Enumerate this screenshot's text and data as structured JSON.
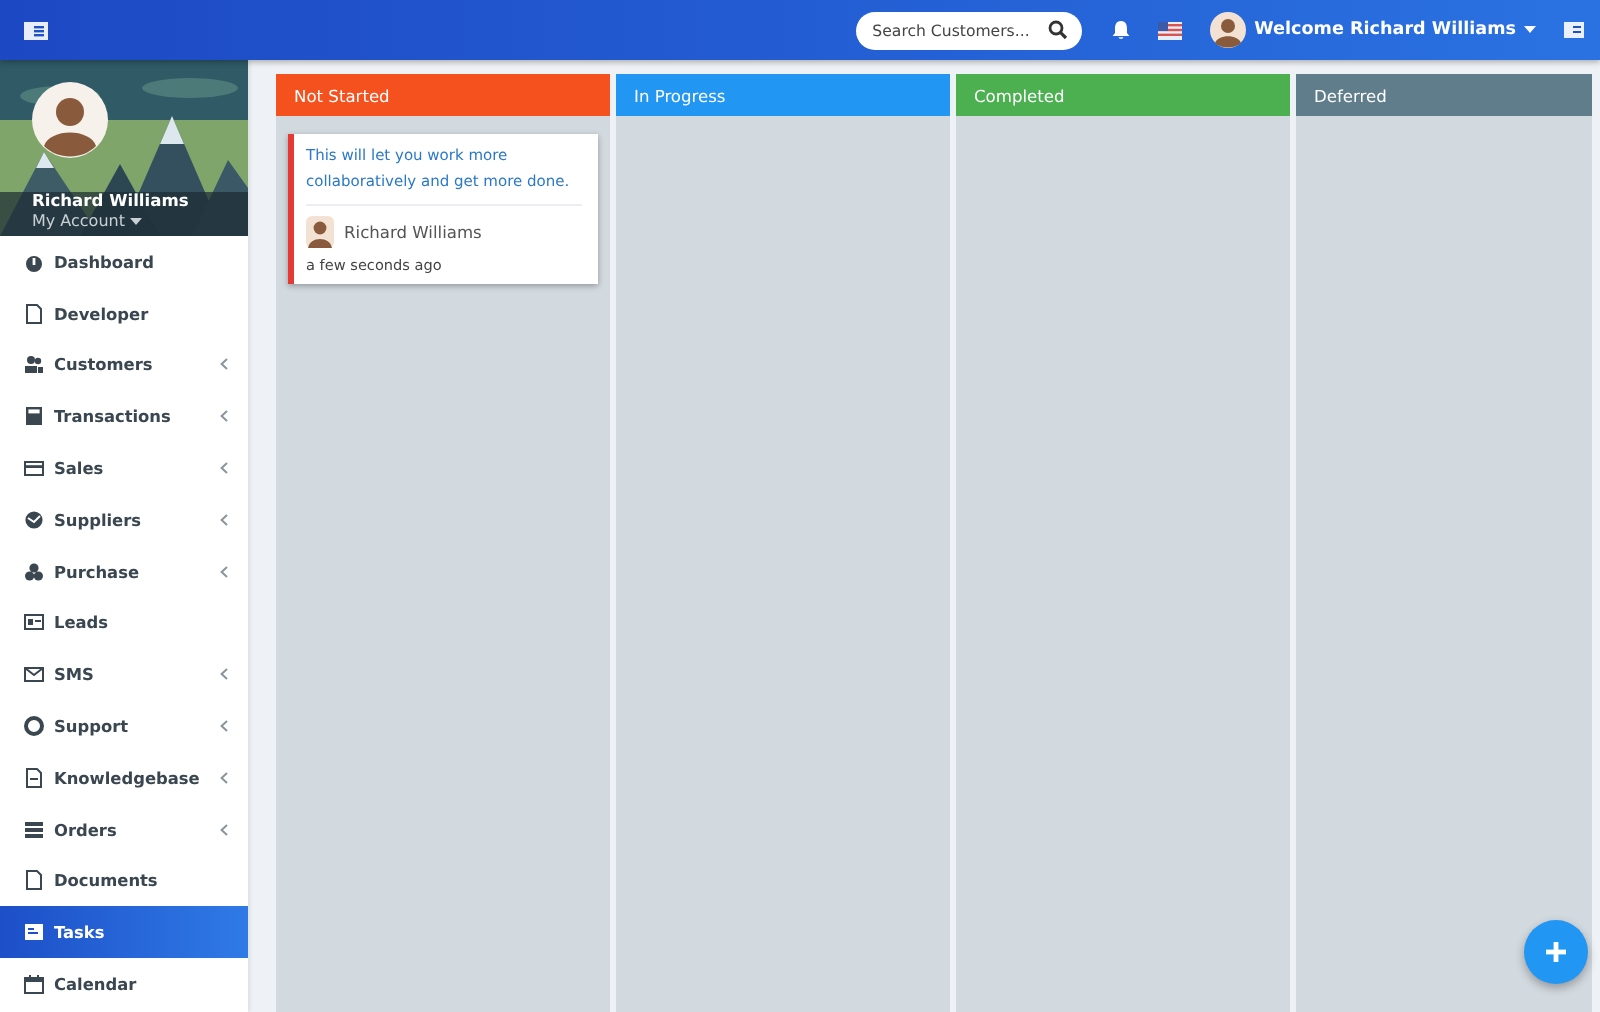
{
  "header": {
    "search": {
      "placeholder": "Search Customers..."
    },
    "welcome": "Welcome Richard Williams"
  },
  "profile": {
    "name": "Richard Williams",
    "account": "My Account"
  },
  "sidebar": {
    "items": [
      {
        "label": "Dashboard",
        "submenu": false,
        "selected": false
      },
      {
        "label": "Developer",
        "submenu": false,
        "selected": false
      },
      {
        "label": "Customers",
        "submenu": true,
        "selected": false
      },
      {
        "label": "Transactions",
        "submenu": true,
        "selected": false
      },
      {
        "label": "Sales",
        "submenu": true,
        "selected": false
      },
      {
        "label": "Suppliers",
        "submenu": true,
        "selected": false
      },
      {
        "label": "Purchase",
        "submenu": true,
        "selected": false
      },
      {
        "label": "Leads",
        "submenu": false,
        "selected": false
      },
      {
        "label": "SMS",
        "submenu": true,
        "selected": false
      },
      {
        "label": "Support",
        "submenu": true,
        "selected": false
      },
      {
        "label": "Knowledgebase",
        "submenu": true,
        "selected": false
      },
      {
        "label": "Orders",
        "submenu": true,
        "selected": false
      },
      {
        "label": "Documents",
        "submenu": false,
        "selected": false
      },
      {
        "label": "Tasks",
        "submenu": false,
        "selected": true
      },
      {
        "label": "Calendar",
        "submenu": false,
        "selected": false
      }
    ]
  },
  "board": {
    "columns": [
      {
        "title": "Not Started",
        "color": "#f4511e",
        "cards": [
          {
            "text": "This will let you work more collaboratively and get more done.",
            "author": "Richard Williams",
            "time": "a few seconds ago"
          }
        ]
      },
      {
        "title": "In Progress",
        "color": "#2196f3"
      },
      {
        "title": "Completed",
        "color": "#4caf50"
      },
      {
        "title": "Deferred",
        "color": "#607d8b"
      }
    ]
  }
}
